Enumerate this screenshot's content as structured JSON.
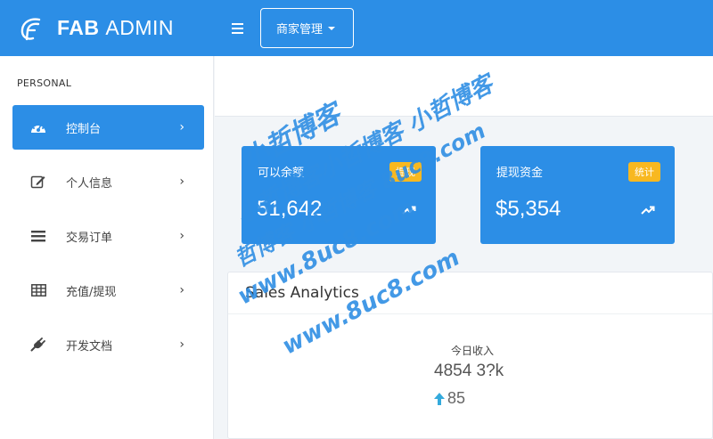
{
  "brand": {
    "name_bold": "FAB",
    "name_rest": "ADMIN"
  },
  "topbar": {
    "dropdown_label": "商家管理"
  },
  "sidebar": {
    "section": "PERSONAL",
    "items": [
      {
        "label": "控制台",
        "icon": "dashboard-icon"
      },
      {
        "label": "个人信息",
        "icon": "edit-icon"
      },
      {
        "label": "交易订单",
        "icon": "list-icon"
      },
      {
        "label": "充值/提现",
        "icon": "table-icon"
      },
      {
        "label": "开发文档",
        "icon": "plug-icon"
      }
    ],
    "chevron": "›"
  },
  "cards": [
    {
      "title": "可以余额",
      "value": "51,642",
      "badge": "提现"
    },
    {
      "title": "提现资金",
      "value": "$5,354",
      "badge": "统计"
    }
  ],
  "analytics": {
    "title": "Sales Analytics",
    "kpi_label": "今日收入",
    "kpi_value": "4854 3?k",
    "kpi_delta": "85"
  },
  "watermark": {
    "line1": "小哲博客",
    "line2": "小哲博客小哲博客 小哲博客",
    "line3": "哲博客 小哲博客 8uc8.com",
    "line4": "www.8uc8.com",
    "line5": "www.8uc8.com"
  },
  "colors": {
    "primary": "#2c8ee6",
    "badge": "#f8b820",
    "trend_up": "#34aadc"
  }
}
